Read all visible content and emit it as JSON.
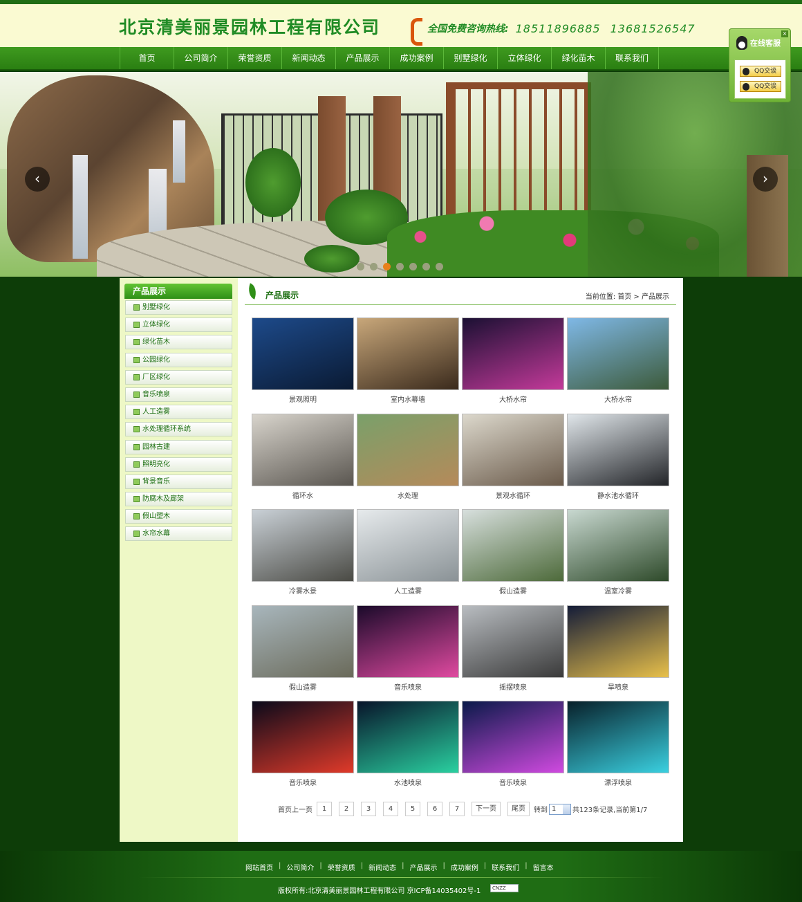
{
  "header": {
    "company": "北京清美丽景园林工程有限公司",
    "hotline_label": "全国免费咨询热线:",
    "phone1": "18511896885",
    "phone2": "13681526547"
  },
  "nav": [
    "首页",
    "公司简介",
    "荣誉资质",
    "新闻动态",
    "产品展示",
    "成功案例",
    "别墅绿化",
    "立体绿化",
    "绿化苗木",
    "联系我们"
  ],
  "qq_widget": {
    "title": "在线客服",
    "btn1": "QQ交谈",
    "btn2": "QQ交谈"
  },
  "banner": {
    "prev": "‹",
    "next": "›",
    "dots": 7,
    "active_dot": 2
  },
  "sidebar": {
    "title": "产品展示",
    "items": [
      "别墅绿化",
      "立体绿化",
      "绿化苗木",
      "公园绿化",
      "厂区绿化",
      "音乐喷泉",
      "人工造雾",
      "水处理循环系统",
      "园林古建",
      "照明亮化",
      "背景音乐",
      "防腐木及廊架",
      "假山塑木",
      "水帘水幕"
    ]
  },
  "content": {
    "title": "产品展示",
    "breadcrumb": "当前位置: 首页 > 产品展示"
  },
  "products": [
    {
      "name": "景观照明",
      "c1": "#1d4a8a",
      "c2": "#0a1a33"
    },
    {
      "name": "室内水幕墙",
      "c1": "#c8a77a",
      "c2": "#3a2a1c"
    },
    {
      "name": "大桥水帘",
      "c1": "#1b1033",
      "c2": "#c43a9a"
    },
    {
      "name": "大桥水帘",
      "c1": "#7fb8e6",
      "c2": "#3c5a3a"
    },
    {
      "name": "循环水",
      "c1": "#d8d4cc",
      "c2": "#5a5650"
    },
    {
      "name": "水处理",
      "c1": "#7aa06a",
      "c2": "#b58a5a"
    },
    {
      "name": "景观水循环",
      "c1": "#dcd8cc",
      "c2": "#6a5a4a"
    },
    {
      "name": "静水池水循环",
      "c1": "#e0e6ea",
      "c2": "#222428"
    },
    {
      "name": "冷雾水景",
      "c1": "#c9d0d6",
      "c2": "#4a4a44"
    },
    {
      "name": "人工造雾",
      "c1": "#e6eaec",
      "c2": "#8a9296"
    },
    {
      "name": "假山造雾",
      "c1": "#d7dfdd",
      "c2": "#4d6a3a"
    },
    {
      "name": "温室冷雾",
      "c1": "#c8d8d0",
      "c2": "#2e4a2a"
    },
    {
      "name": "假山造雾",
      "c1": "#a8b6bc",
      "c2": "#6a6a5a"
    },
    {
      "name": "音乐喷泉",
      "c1": "#1a0a2a",
      "c2": "#e04aa0"
    },
    {
      "name": "摇摆喷泉",
      "c1": "#b8bcc0",
      "c2": "#3a3a3a"
    },
    {
      "name": "旱喷泉",
      "c1": "#141c38",
      "c2": "#e8c04a"
    },
    {
      "name": "音乐喷泉",
      "c1": "#0a0a1a",
      "c2": "#e03a2a"
    },
    {
      "name": "水池喷泉",
      "c1": "#08142a",
      "c2": "#2ad0a0"
    },
    {
      "name": "音乐喷泉",
      "c1": "#0a1a4a",
      "c2": "#d04ae0"
    },
    {
      "name": "漂浮喷泉",
      "c1": "#08202a",
      "c2": "#3ad0e0"
    }
  ],
  "pager": {
    "first": "首页",
    "prev": "上一页",
    "pages": [
      "1",
      "2",
      "3",
      "4",
      "5",
      "6",
      "7"
    ],
    "next": "下一页",
    "last": "尾页",
    "goto": "转到",
    "selected": "1",
    "summary": "共123条记录,当前第1/7"
  },
  "footer": {
    "links": [
      "网站首页",
      "公司简介",
      "荣誉资质",
      "新闻动态",
      "产品展示",
      "成功案例",
      "联系我们",
      "留言本"
    ],
    "copyright": "版权所有:北京清美丽景园林工程有限公司   京ICP备14035402号-1",
    "cnzz": "CNZZ"
  }
}
